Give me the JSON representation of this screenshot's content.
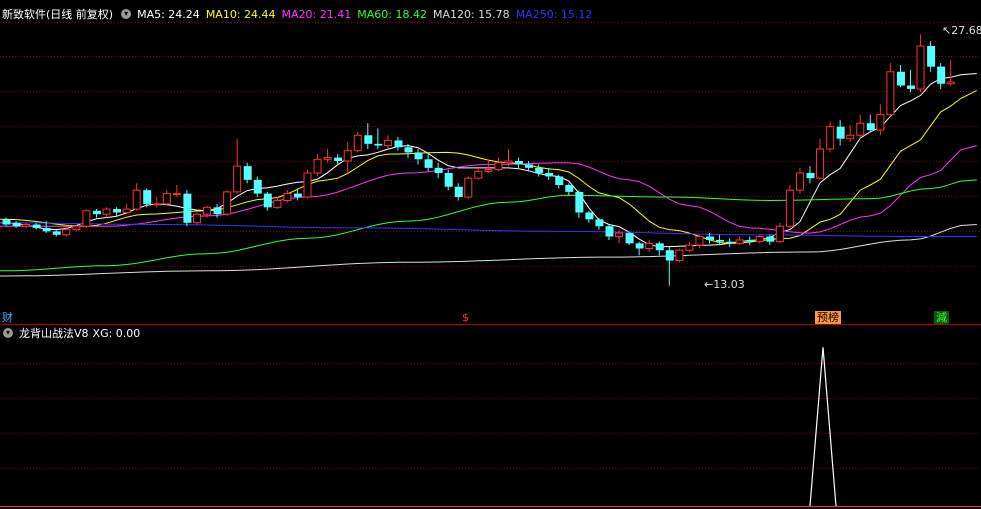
{
  "main_panel": {
    "title": "新致软件(日线 前复权)",
    "ma_labels": [
      {
        "text": "MA5: 24.24",
        "color": "#ffffff"
      },
      {
        "text": "MA10: 24.44",
        "color": "#ffff00"
      },
      {
        "text": "MA20: 21.41",
        "color": "#ff33ff"
      },
      {
        "text": "MA60: 18.42",
        "color": "#33ff33"
      },
      {
        "text": "MA120: 15.78",
        "color": "#dddddd"
      },
      {
        "text": "MA250: 15.12",
        "color": "#3333ff"
      }
    ],
    "high_marker": "27.68",
    "low_marker": "13.03",
    "event_tags": [
      {
        "text": "财",
        "color": "#4da6ff"
      },
      {
        "text": "$",
        "color": "#ff3333"
      },
      {
        "text": "预榜",
        "color": "#ff9900"
      },
      {
        "text": "減",
        "color": "#33ff33"
      }
    ]
  },
  "sub_panel": {
    "title": "龙背山战法V8",
    "xg_label": "XG: 0.00",
    "xg_spike_fraction": 0.95
  },
  "colors": {
    "up": "#ff3232",
    "down": "#54ffff",
    "grid": "#8b0000",
    "divider": "#b00000"
  },
  "chart_data": {
    "type": "candlestick",
    "ohlc": [
      [
        16.9,
        16.6,
        17.0,
        16.5
      ],
      [
        16.7,
        16.5,
        16.8,
        16.4
      ],
      [
        16.5,
        16.6,
        16.7,
        16.4
      ],
      [
        16.6,
        16.4,
        16.7,
        16.3
      ],
      [
        16.4,
        16.2,
        16.8,
        16.1
      ],
      [
        16.2,
        16.0,
        16.3,
        15.9
      ],
      [
        16.0,
        16.3,
        16.5,
        15.9
      ],
      [
        16.3,
        16.5,
        16.6,
        16.2
      ],
      [
        16.5,
        17.4,
        17.5,
        16.4
      ],
      [
        17.4,
        17.2,
        17.5,
        17.0
      ],
      [
        17.2,
        17.5,
        17.6,
        17.0
      ],
      [
        17.5,
        17.3,
        17.6,
        17.1
      ],
      [
        17.3,
        17.5,
        17.8,
        17.2
      ],
      [
        17.5,
        18.6,
        19.0,
        17.4
      ],
      [
        18.6,
        17.8,
        18.7,
        17.6
      ],
      [
        17.8,
        17.8,
        18.2,
        17.6
      ],
      [
        17.8,
        18.4,
        18.6,
        17.7
      ],
      [
        18.4,
        18.4,
        18.9,
        18.2
      ],
      [
        18.4,
        16.7,
        18.6,
        16.5
      ],
      [
        16.7,
        17.2,
        17.3,
        16.6
      ],
      [
        17.2,
        17.6,
        17.7,
        17.0
      ],
      [
        17.6,
        17.2,
        17.8,
        17.0
      ],
      [
        17.2,
        18.5,
        18.6,
        17.1
      ],
      [
        18.5,
        20.0,
        21.6,
        18.4
      ],
      [
        20.0,
        19.2,
        20.2,
        19.0
      ],
      [
        19.2,
        18.4,
        19.4,
        18.2
      ],
      [
        18.4,
        17.6,
        18.5,
        17.4
      ],
      [
        17.6,
        18.0,
        18.2,
        17.5
      ],
      [
        18.0,
        18.4,
        18.6,
        17.9
      ],
      [
        18.4,
        18.2,
        18.7,
        18.0
      ],
      [
        18.2,
        19.6,
        19.8,
        18.1
      ],
      [
        19.6,
        20.4,
        20.7,
        19.4
      ],
      [
        20.4,
        20.5,
        21.0,
        20.2
      ],
      [
        20.5,
        20.3,
        20.7,
        20.1
      ],
      [
        20.3,
        20.9,
        21.4,
        19.5
      ],
      [
        20.9,
        21.8,
        22.0,
        20.8
      ],
      [
        21.8,
        21.3,
        22.5,
        21.0
      ],
      [
        21.3,
        21.2,
        22.2,
        21.0
      ],
      [
        21.2,
        21.5,
        21.8,
        21.0
      ],
      [
        21.5,
        21.1,
        21.7,
        20.9
      ],
      [
        21.1,
        20.8,
        21.3,
        20.5
      ],
      [
        20.8,
        20.4,
        21.0,
        20.1
      ],
      [
        20.4,
        19.9,
        20.8,
        19.7
      ],
      [
        19.9,
        19.6,
        20.2,
        19.3
      ],
      [
        19.6,
        18.8,
        19.8,
        18.6
      ],
      [
        18.8,
        18.2,
        19.0,
        18.0
      ],
      [
        18.2,
        19.3,
        19.4,
        18.1
      ],
      [
        19.3,
        19.7,
        19.9,
        19.2
      ],
      [
        19.7,
        19.8,
        20.4,
        19.6
      ],
      [
        19.8,
        20.2,
        20.5,
        19.7
      ],
      [
        20.2,
        20.3,
        21.0,
        20.0
      ],
      [
        20.3,
        20.1,
        20.5,
        19.9
      ],
      [
        20.1,
        19.9,
        20.3,
        19.7
      ],
      [
        19.9,
        19.6,
        20.1,
        19.4
      ],
      [
        19.6,
        19.4,
        19.9,
        19.2
      ],
      [
        19.4,
        18.9,
        19.5,
        18.7
      ],
      [
        18.9,
        18.5,
        19.0,
        18.3
      ],
      [
        18.5,
        17.3,
        18.6,
        17.0
      ],
      [
        17.3,
        16.9,
        17.4,
        16.7
      ],
      [
        16.9,
        16.5,
        17.0,
        16.3
      ],
      [
        16.5,
        15.9,
        16.6,
        15.7
      ],
      [
        15.9,
        16.1,
        16.3,
        15.5
      ],
      [
        16.1,
        15.5,
        16.2,
        15.4
      ],
      [
        15.5,
        15.2,
        15.6,
        14.8
      ],
      [
        15.2,
        15.5,
        15.7,
        15.0
      ],
      [
        15.5,
        15.1,
        15.6,
        14.8
      ],
      [
        15.1,
        14.5,
        15.3,
        13.03
      ],
      [
        14.5,
        15.1,
        15.2,
        14.4
      ],
      [
        15.1,
        15.4,
        15.6,
        15.0
      ],
      [
        15.4,
        15.9,
        16.0,
        15.2
      ],
      [
        15.9,
        15.7,
        16.1,
        15.5
      ],
      [
        15.7,
        15.6,
        16.0,
        15.4
      ],
      [
        15.6,
        15.5,
        15.8,
        15.3
      ],
      [
        15.5,
        15.7,
        15.9,
        15.4
      ],
      [
        15.7,
        15.6,
        15.9,
        15.4
      ],
      [
        15.6,
        15.9,
        16.0,
        15.5
      ],
      [
        15.9,
        15.6,
        16.0,
        15.4
      ],
      [
        15.6,
        16.5,
        16.7,
        15.5
      ],
      [
        16.5,
        18.6,
        18.9,
        16.4
      ],
      [
        18.6,
        19.6,
        19.9,
        18.4
      ],
      [
        19.6,
        19.3,
        20.0,
        19.0
      ],
      [
        19.3,
        21.0,
        21.6,
        19.2
      ],
      [
        21.0,
        22.3,
        22.6,
        20.8
      ],
      [
        22.3,
        21.6,
        22.7,
        21.2
      ],
      [
        21.6,
        21.8,
        22.4,
        21.4
      ],
      [
        21.8,
        22.5,
        23.0,
        21.6
      ],
      [
        22.5,
        22.1,
        23.0,
        22.0
      ],
      [
        22.1,
        23.0,
        23.6,
        21.8
      ],
      [
        23.0,
        25.5,
        26.0,
        22.9
      ],
      [
        25.5,
        24.7,
        25.9,
        24.6
      ],
      [
        24.7,
        24.5,
        25.6,
        24.3
      ],
      [
        24.5,
        27.0,
        27.68,
        24.3
      ],
      [
        27.0,
        25.8,
        27.3,
        25.5
      ],
      [
        25.8,
        24.8,
        26.0,
        24.5
      ],
      [
        24.8,
        24.9,
        26.2,
        24.7
      ]
    ],
    "price_range": [
      12.2,
      28.4
    ],
    "ma_series": [
      {
        "name": "MA5",
        "color": "#ffffff",
        "anchors": [
          [
            0,
            16.7
          ],
          [
            5,
            16.3
          ],
          [
            10,
            17.0
          ],
          [
            15,
            17.8
          ],
          [
            20,
            17.4
          ],
          [
            25,
            18.7
          ],
          [
            30,
            19.1
          ],
          [
            35,
            20.6
          ],
          [
            40,
            21.2
          ],
          [
            45,
            19.9
          ],
          [
            50,
            19.9
          ],
          [
            55,
            19.4
          ],
          [
            60,
            16.6
          ],
          [
            65,
            15.3
          ],
          [
            70,
            15.4
          ],
          [
            75,
            15.7
          ],
          [
            78,
            16.3
          ],
          [
            82,
            19.5
          ],
          [
            86,
            22.0
          ],
          [
            90,
            23.8
          ],
          [
            93,
            25.1
          ],
          [
            96,
            25.4
          ]
        ]
      },
      {
        "name": "MA10",
        "color": "#ffff00",
        "anchors": [
          [
            0,
            16.9
          ],
          [
            8,
            16.5
          ],
          [
            14,
            17.2
          ],
          [
            20,
            17.4
          ],
          [
            26,
            18.1
          ],
          [
            32,
            19.2
          ],
          [
            38,
            20.7
          ],
          [
            44,
            20.8
          ],
          [
            50,
            20.2
          ],
          [
            55,
            19.8
          ],
          [
            60,
            18.3
          ],
          [
            66,
            16.3
          ],
          [
            72,
            15.5
          ],
          [
            78,
            15.8
          ],
          [
            82,
            16.9
          ],
          [
            86,
            18.9
          ],
          [
            90,
            21.2
          ],
          [
            94,
            23.5
          ],
          [
            96,
            24.4
          ]
        ]
      },
      {
        "name": "MA20",
        "color": "#ff33ff",
        "anchors": [
          [
            0,
            16.5
          ],
          [
            10,
            16.5
          ],
          [
            20,
            17.1
          ],
          [
            30,
            18.2
          ],
          [
            40,
            19.6
          ],
          [
            48,
            20.1
          ],
          [
            56,
            20.2
          ],
          [
            62,
            19.2
          ],
          [
            68,
            17.7
          ],
          [
            74,
            16.4
          ],
          [
            80,
            16.1
          ],
          [
            86,
            17.1
          ],
          [
            92,
            19.5
          ],
          [
            96,
            21.2
          ]
        ]
      },
      {
        "name": "MA60",
        "color": "#33ff33",
        "anchors": [
          [
            0,
            13.9
          ],
          [
            10,
            14.2
          ],
          [
            20,
            14.9
          ],
          [
            30,
            15.8
          ],
          [
            40,
            16.8
          ],
          [
            50,
            17.9
          ],
          [
            56,
            18.3
          ],
          [
            66,
            18.2
          ],
          [
            76,
            18.0
          ],
          [
            86,
            18.1
          ],
          [
            92,
            18.7
          ],
          [
            96,
            19.2
          ]
        ]
      },
      {
        "name": "MA120",
        "color": "#dddddd",
        "anchors": [
          [
            0,
            13.6
          ],
          [
            20,
            13.9
          ],
          [
            40,
            14.4
          ],
          [
            60,
            14.7
          ],
          [
            80,
            15.0
          ],
          [
            90,
            15.7
          ],
          [
            96,
            16.6
          ]
        ]
      },
      {
        "name": "MA250",
        "color": "#3333ff",
        "anchors": [
          [
            0,
            16.7
          ],
          [
            15,
            16.6
          ],
          [
            35,
            16.4
          ],
          [
            55,
            16.2
          ],
          [
            75,
            16.0
          ],
          [
            90,
            15.9
          ],
          [
            96,
            15.9
          ]
        ]
      }
    ]
  }
}
